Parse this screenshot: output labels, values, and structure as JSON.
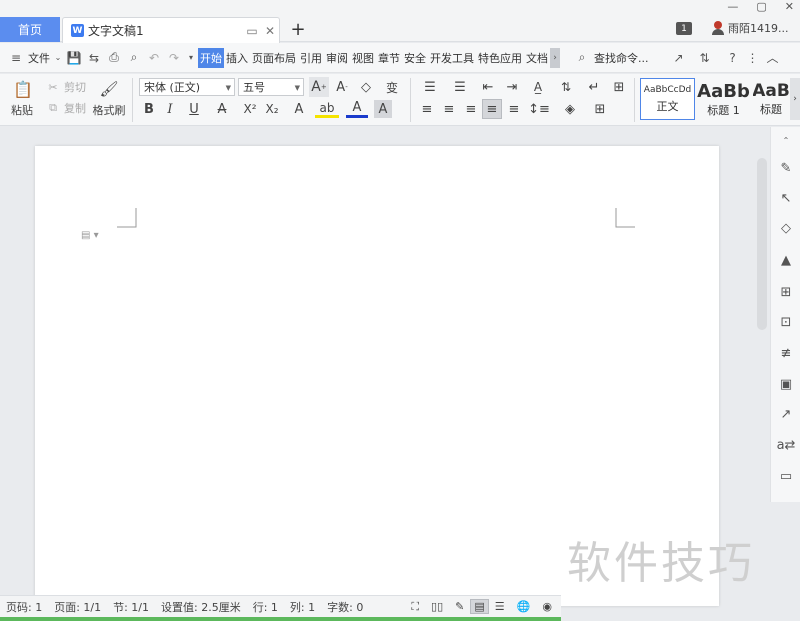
{
  "tabs": {
    "home": "首页",
    "document": "文字文稿1"
  },
  "titlebar": {
    "badge": "1",
    "user_name": "雨陌1419..."
  },
  "menubar": {
    "file": "文件",
    "items": [
      "开始",
      "插入",
      "页面布局",
      "引用",
      "审阅",
      "视图",
      "章节",
      "安全",
      "开发工具",
      "特色应用",
      "文档"
    ],
    "search": "查找命令..."
  },
  "ribbon": {
    "paste": "粘贴",
    "cut": "剪切",
    "copy": "复制",
    "format_painter": "格式刷",
    "font_name": "宋体 (正文)",
    "font_size": "五号",
    "styles": [
      {
        "preview": "AaBbCcDd",
        "label": "正文"
      },
      {
        "preview": "AaBb",
        "label": "标题 1"
      },
      {
        "preview": "AaB",
        "label": "标题"
      }
    ]
  },
  "statusbar": {
    "page_no": "页码: 1",
    "pages": "页面: 1/1",
    "section": "节: 1/1",
    "setting": "设置值: 2.5厘米",
    "row": "行: 1",
    "col": "列: 1",
    "words": "字数: 0"
  },
  "watermark": "软件技巧",
  "colors": {
    "accent": "#4f86e8",
    "home_tab": "#5b8def",
    "status_green": "#5cb85c"
  }
}
